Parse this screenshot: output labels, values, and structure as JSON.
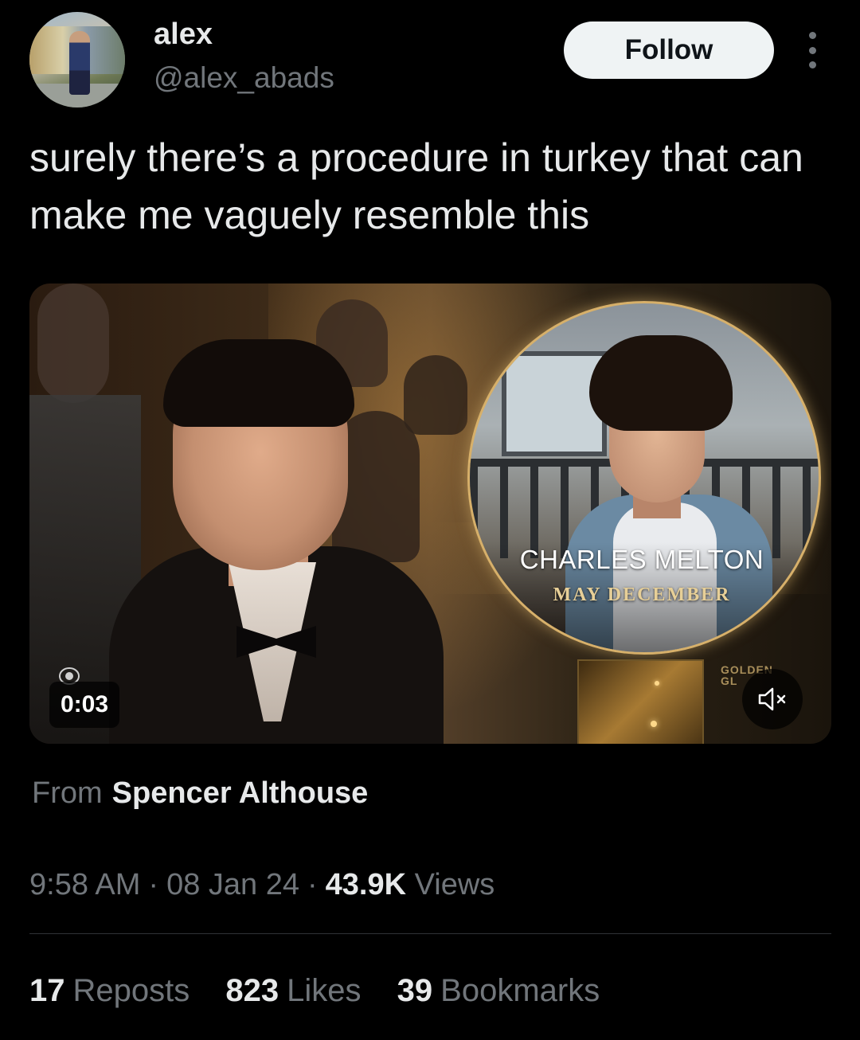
{
  "author": {
    "display_name": "alex",
    "handle": "@alex_abads",
    "follow_label": "Follow"
  },
  "tweet": {
    "text": "surely there’s a procedure in turkey that can make me vaguely resemble this"
  },
  "media": {
    "overlay_name": "CHARLES MELTON",
    "overlay_film": "MAY DECEMBER",
    "corner_mark": "GOLDEN GL",
    "video_time": "0:03",
    "icons": {
      "mute": "speaker-muted-icon",
      "network": "cbs-eye-icon",
      "more": "more-dots-icon"
    }
  },
  "source": {
    "prefix": "From",
    "name": "Spencer Althouse"
  },
  "meta": {
    "time": "9:58 AM",
    "date": "08 Jan 24",
    "views_count": "43.9K",
    "views_label": "Views",
    "separator": "·"
  },
  "stats": {
    "reposts_count": "17",
    "reposts_label": "Reposts",
    "likes_count": "823",
    "likes_label": "Likes",
    "bookmarks_count": "39",
    "bookmarks_label": "Bookmarks"
  },
  "colors": {
    "background": "#000000",
    "primary_text": "#e7e9ea",
    "secondary_text": "#71767b",
    "follow_button_bg": "#eff3f4",
    "divider": "#2f3336",
    "overlay_gold": "#d7b06a"
  }
}
